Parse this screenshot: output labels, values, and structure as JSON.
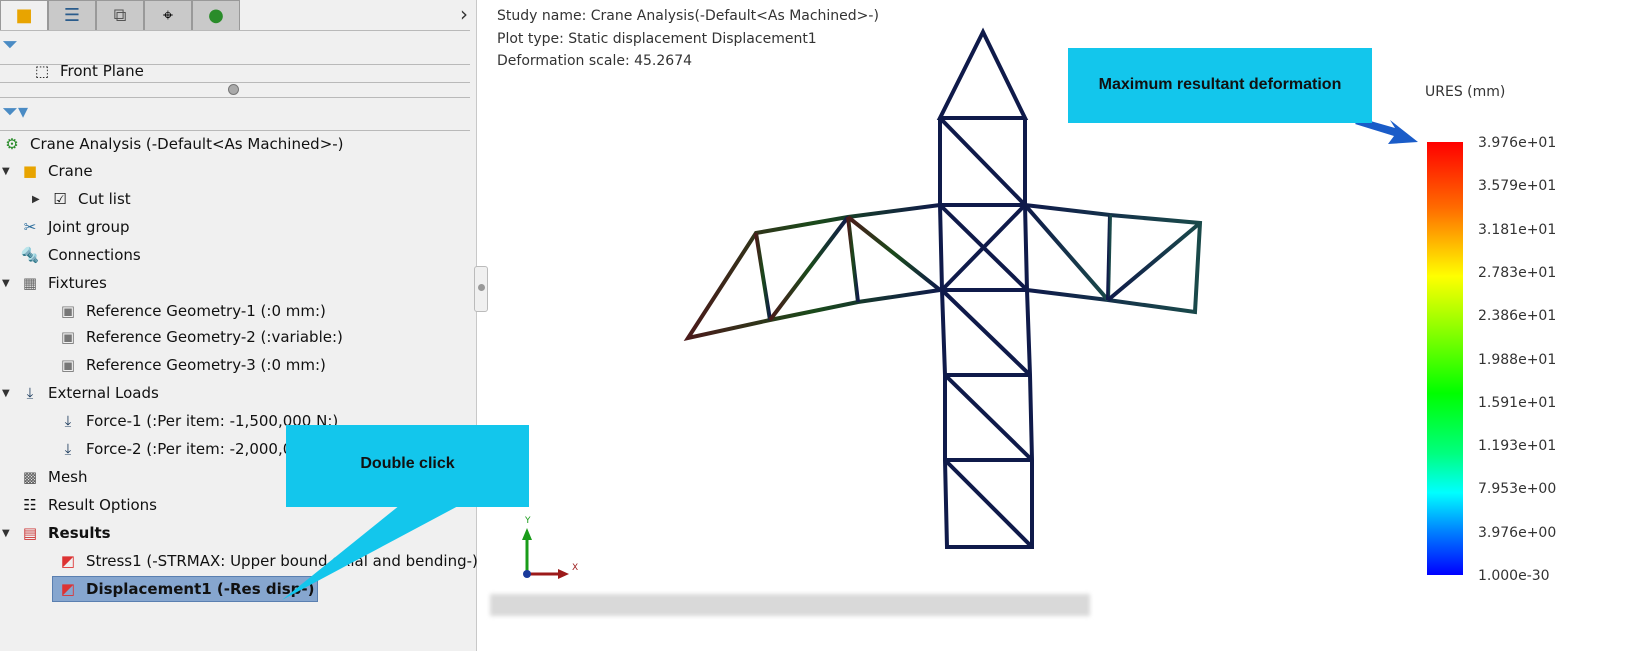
{
  "tabs": [
    {
      "icon": "part-icon"
    },
    {
      "icon": "property-manager-icon"
    },
    {
      "icon": "configuration-manager-icon"
    },
    {
      "icon": "dimxpert-icon"
    },
    {
      "icon": "appearance-icon"
    }
  ],
  "top_tree": {
    "item": "Front Plane"
  },
  "tree": {
    "study": "Crane Analysis (-Default<As Machined>-)",
    "crane": "Crane",
    "cut_list": "Cut list",
    "joint_group": "Joint group",
    "connections": "Connections",
    "fixtures": "Fixtures",
    "fixture_items": [
      "Reference Geometry-1 (:0 mm:)",
      "Reference Geometry-2 (:variable:)",
      "Reference Geometry-3 (:0 mm:)"
    ],
    "external_loads": "External Loads",
    "loads": [
      "Force-1 (:Per item: -1,500,000 N:)",
      "Force-2 (:Per item: -2,000,000 N:)"
    ],
    "mesh": "Mesh",
    "result_options": "Result Options",
    "results": "Results",
    "stress": "Stress1 (-STRMAX: Upper bound axial and bending-)",
    "displacement": "Displacement1 (-Res disp-)"
  },
  "viewport": {
    "study_name": "Study name: Crane Analysis(-Default<As Machined>-)",
    "plot_type": "Plot type: Static displacement Displacement1",
    "deformation_scale": "Deformation scale: 45.2674",
    "axis_x": "X",
    "axis_y": "Y"
  },
  "legend": {
    "title": "URES (mm)",
    "ticks": [
      "3.976e+01",
      "3.579e+01",
      "3.181e+01",
      "2.783e+01",
      "2.386e+01",
      "1.988e+01",
      "1.591e+01",
      "1.193e+01",
      "7.953e+00",
      "3.976e+00",
      "1.000e-30"
    ]
  },
  "callouts": {
    "double_click": "Double click",
    "max_deformation": "Maximum resultant deformation"
  },
  "colors": {
    "callout": "#13c6ec",
    "selection": "#86a6cf",
    "truss": "#0f1a4a"
  }
}
